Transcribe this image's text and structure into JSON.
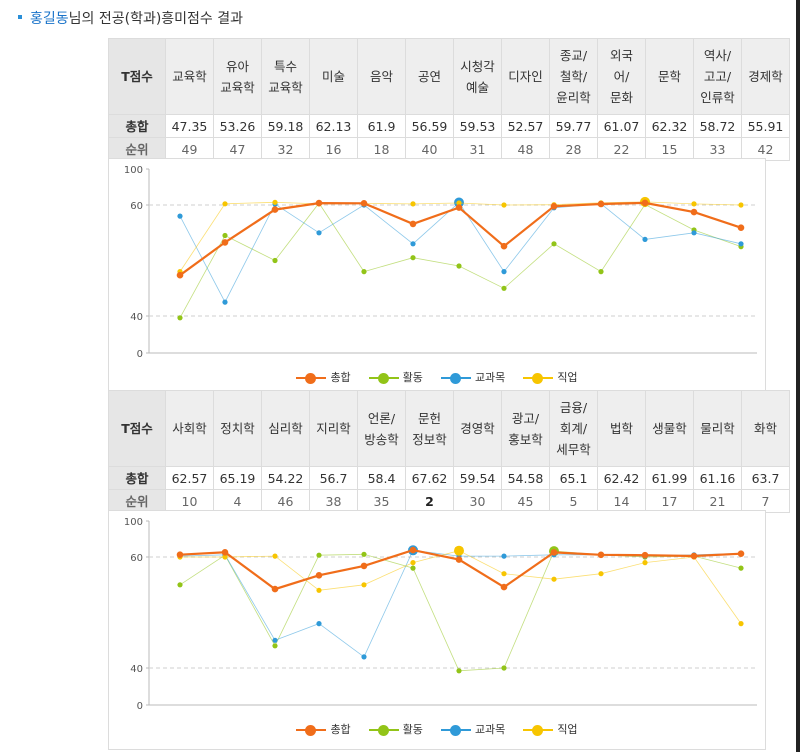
{
  "title": {
    "name": "홍길동",
    "rest": "님의 전공(학과)흥미점수 결과"
  },
  "legend": [
    {
      "key": "total",
      "label": "총합",
      "color": "#f06d1a"
    },
    {
      "key": "activity",
      "label": "활동",
      "color": "#92c418"
    },
    {
      "key": "subject",
      "label": "교과목",
      "color": "#2f9ad8"
    },
    {
      "key": "job",
      "label": "직업",
      "color": "#f7c500"
    }
  ],
  "tables": [
    {
      "header_label": "T점수",
      "sum_label": "총합",
      "rank_label": "순위",
      "columns": [
        {
          "name": "교육학",
          "sum": "47.35",
          "rank": "49"
        },
        {
          "name": "유아\n교육학",
          "sum": "53.26",
          "rank": "47"
        },
        {
          "name": "특수\n교육학",
          "sum": "59.18",
          "rank": "32"
        },
        {
          "name": "미술",
          "sum": "62.13",
          "rank": "16"
        },
        {
          "name": "음악",
          "sum": "61.9",
          "rank": "18"
        },
        {
          "name": "공연",
          "sum": "56.59",
          "rank": "40"
        },
        {
          "name": "시청각\n예술",
          "sum": "59.53",
          "rank": "31"
        },
        {
          "name": "디자인",
          "sum": "52.57",
          "rank": "48"
        },
        {
          "name": "종교/\n철학/\n윤리학",
          "sum": "59.77",
          "rank": "28"
        },
        {
          "name": "외국\n어/\n문화",
          "sum": "61.07",
          "rank": "22"
        },
        {
          "name": "문학",
          "sum": "62.32",
          "rank": "15"
        },
        {
          "name": "역사/\n고고/\n인류학",
          "sum": "58.72",
          "rank": "33"
        },
        {
          "name": "경제학",
          "sum": "55.91",
          "rank": "42"
        }
      ]
    },
    {
      "header_label": "T점수",
      "sum_label": "총합",
      "rank_label": "순위",
      "columns": [
        {
          "name": "사회학",
          "sum": "62.57",
          "rank": "10"
        },
        {
          "name": "정치학",
          "sum": "65.19",
          "rank": "4"
        },
        {
          "name": "심리학",
          "sum": "54.22",
          "rank": "46"
        },
        {
          "name": "지리학",
          "sum": "56.7",
          "rank": "38"
        },
        {
          "name": "언론/\n방송학",
          "sum": "58.4",
          "rank": "35"
        },
        {
          "name": "문헌\n정보학",
          "sum": "67.62",
          "rank": "2"
        },
        {
          "name": "경영학",
          "sum": "59.54",
          "rank": "30"
        },
        {
          "name": "광고/\n홍보학",
          "sum": "54.58",
          "rank": "45"
        },
        {
          "name": "금융/\n회계/\n세무학",
          "sum": "65.1",
          "rank": "5"
        },
        {
          "name": "법학",
          "sum": "62.42",
          "rank": "14"
        },
        {
          "name": "생물학",
          "sum": "61.99",
          "rank": "17"
        },
        {
          "name": "물리학",
          "sum": "61.16",
          "rank": "21"
        },
        {
          "name": "화학",
          "sum": "63.7",
          "rank": "7"
        }
      ]
    }
  ],
  "chart_data": [
    {
      "type": "line",
      "categories": [
        "교육학",
        "유아 교육학",
        "특수 교육학",
        "미술",
        "음악",
        "공연",
        "시청각 예술",
        "디자인",
        "종교/철학/윤리학",
        "외국어/문화",
        "문학",
        "역사/고고/인류학",
        "경제학"
      ],
      "y_ticks": [
        "100",
        "60",
        "40",
        "0"
      ],
      "gridlines": [
        "60",
        "40"
      ],
      "legend_position": "bottom",
      "series": [
        {
          "name": "총합",
          "color": "#f06d1a",
          "values": [
            47.35,
            53.26,
            59.18,
            62.13,
            61.9,
            56.59,
            59.53,
            52.57,
            59.77,
            61.07,
            62.32,
            58.72,
            55.91
          ]
        },
        {
          "name": "활동",
          "color": "#92c418",
          "values": [
            38,
            54.5,
            50,
            62.1,
            48,
            50.5,
            49,
            45,
            53,
            48,
            60.5,
            55.5,
            52.5
          ]
        },
        {
          "name": "교과목",
          "color": "#2f9ad8",
          "values": [
            58,
            42.5,
            61,
            55,
            60,
            53,
            62.8,
            48,
            59.5,
            61.3,
            53.8,
            55,
            53
          ]
        },
        {
          "name": "직업",
          "color": "#f7c500",
          "values": [
            48,
            61.3,
            63,
            61.2,
            61.8,
            61.2,
            62.2,
            60,
            60.3,
            62.5,
            63.5,
            61.2,
            60
          ]
        }
      ],
      "highlights": [
        {
          "series": "교과목",
          "index": 6
        },
        {
          "series": "직업",
          "index": 10
        }
      ]
    },
    {
      "type": "line",
      "categories": [
        "사회학",
        "정치학",
        "심리학",
        "지리학",
        "언론/방송학",
        "문헌 정보학",
        "경영학",
        "광고/홍보학",
        "금융/회계/세무학",
        "법학",
        "생물학",
        "물리학",
        "화학"
      ],
      "y_ticks": [
        "100",
        "60",
        "40",
        "0"
      ],
      "gridlines": [
        "60",
        "40"
      ],
      "legend_position": "bottom",
      "series": [
        {
          "name": "총합",
          "color": "#f06d1a",
          "values": [
            62.57,
            65.19,
            54.22,
            56.7,
            58.4,
            67.62,
            59.54,
            54.58,
            65.1,
            62.42,
            61.99,
            61.16,
            63.7
          ]
        },
        {
          "name": "활동",
          "color": "#92c418",
          "values": [
            55,
            62,
            44,
            62,
            63,
            58,
            37,
            40,
            66.5,
            62.5,
            60,
            61,
            58
          ]
        },
        {
          "name": "교과목",
          "color": "#2f9ad8",
          "values": [
            61,
            62.5,
            45,
            48,
            42,
            67.5,
            61,
            61,
            62.5,
            62.5,
            61,
            62.5,
            64
          ]
        },
        {
          "name": "직업",
          "color": "#f7c500",
          "values": [
            60,
            60,
            61,
            54,
            55,
            59,
            67,
            57,
            56,
            57,
            59,
            60,
            48
          ]
        }
      ],
      "highlights": [
        {
          "series": "교과목",
          "index": 5
        },
        {
          "series": "직업",
          "index": 6
        },
        {
          "series": "활동",
          "index": 8
        }
      ]
    }
  ]
}
